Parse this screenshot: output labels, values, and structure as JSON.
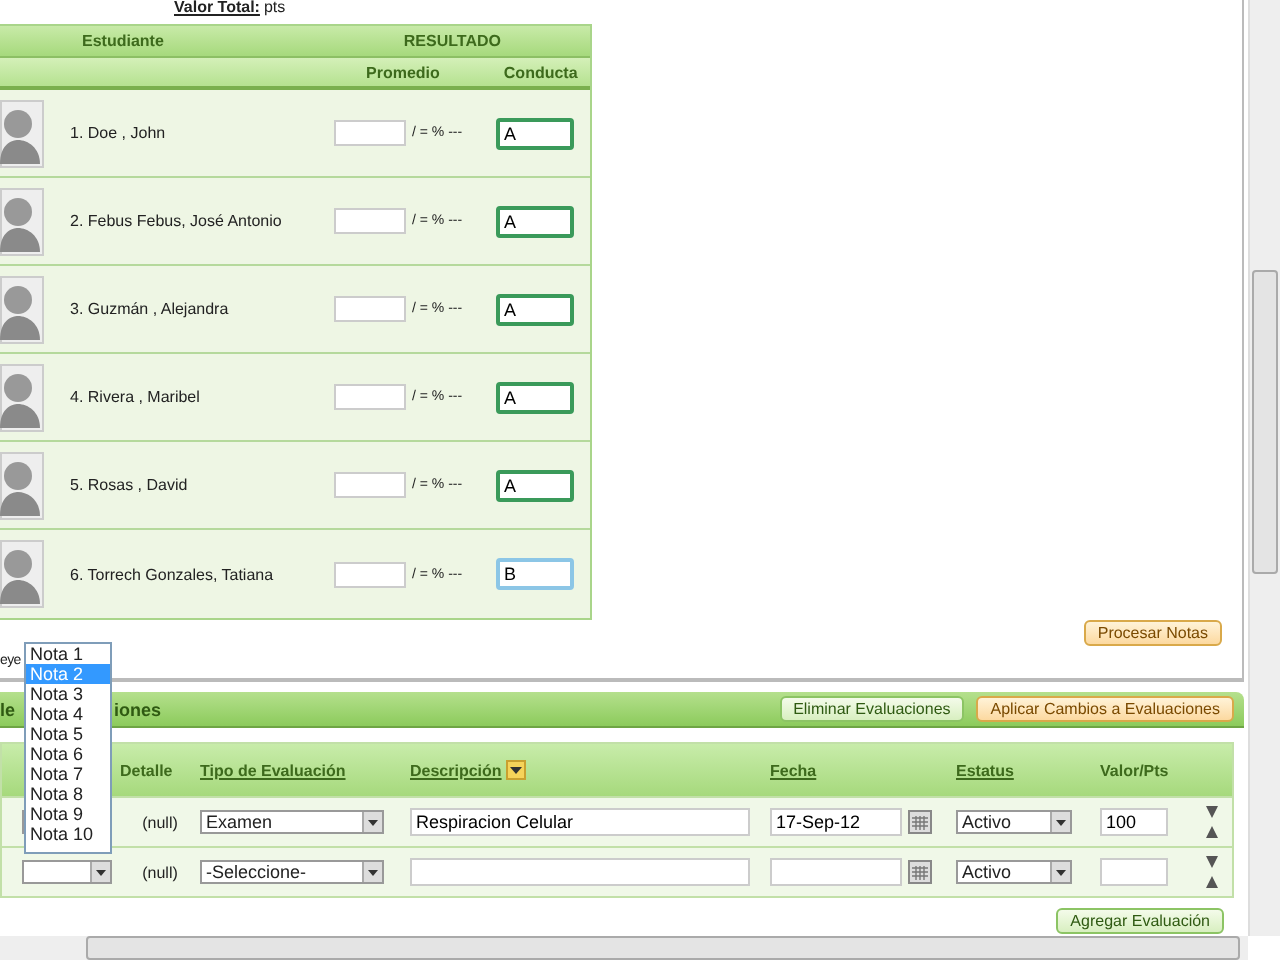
{
  "valor_total": {
    "label": "Valor Total:",
    "unit": "pts"
  },
  "students_table": {
    "columns": [
      "Estudiante",
      "RESULTADO"
    ],
    "subcolumns": [
      "Promedio",
      "Conducta"
    ],
    "rows": [
      {
        "name": "1. Doe , John",
        "formula": "/ = % ---",
        "conducta": "A",
        "focused": false
      },
      {
        "name": "2. Febus Febus, José Antonio",
        "formula": "/ = % ---",
        "conducta": "A",
        "focused": false
      },
      {
        "name": "3. Guzmán , Alejandra",
        "formula": "/ = % ---",
        "conducta": "A",
        "focused": false
      },
      {
        "name": "4. Rivera , Maribel",
        "formula": "/ = % ---",
        "conducta": "A",
        "focused": false
      },
      {
        "name": "5. Rosas , David",
        "formula": "/ = % ---",
        "conducta": "A",
        "focused": false
      },
      {
        "name": "6. Torrech Gonzales, Tatiana",
        "formula": "/ = % ---",
        "conducta": "B",
        "focused": true
      }
    ]
  },
  "procesar_button": "Procesar Notas",
  "note_fragment": "eye",
  "evaluations": {
    "title_start": "le",
    "title_end": "iones",
    "buttons": [
      {
        "label": "Eliminar Evaluaciones",
        "kind": "plain"
      },
      {
        "label": "Aplicar Cambios a Evaluaciones",
        "kind": "highlight"
      }
    ],
    "columns": [
      {
        "label": "Detalle",
        "link": false,
        "sort_icon": false
      },
      {
        "label": "Tipo de Evaluación",
        "link": true,
        "sort_icon": false
      },
      {
        "label": "Descripción",
        "link": true,
        "sort_icon": true
      },
      {
        "label": "Fecha",
        "link": true,
        "sort_icon": false
      },
      {
        "label": "Estatus",
        "link": true,
        "sort_icon": false
      },
      {
        "label": "Valor/Pts",
        "link": false,
        "sort_icon": false
      }
    ],
    "rows": [
      {
        "detalle": "(null)",
        "tipo": "Examen",
        "descripcion": "Respiracion Celular",
        "fecha": "17-Sep-12",
        "estatus": "Activo",
        "valor": "100"
      },
      {
        "detalle": "(null)",
        "tipo": "-Seleccione-",
        "estatus": "Activo"
      }
    ],
    "add_button": "Agregar Evaluación"
  },
  "dropdown": {
    "options": [
      {
        "label": "Nota 1",
        "selected": false
      },
      {
        "label": "Nota 2",
        "selected": true
      },
      {
        "label": "Nota 3",
        "selected": false
      },
      {
        "label": "Nota 4",
        "selected": false
      },
      {
        "label": "Nota 5",
        "selected": false
      },
      {
        "label": "Nota 6",
        "selected": false
      },
      {
        "label": "Nota 7",
        "selected": false
      },
      {
        "label": "Nota 8",
        "selected": false
      },
      {
        "label": "Nota 9",
        "selected": false
      },
      {
        "label": "Nota 10",
        "selected": false
      }
    ]
  }
}
